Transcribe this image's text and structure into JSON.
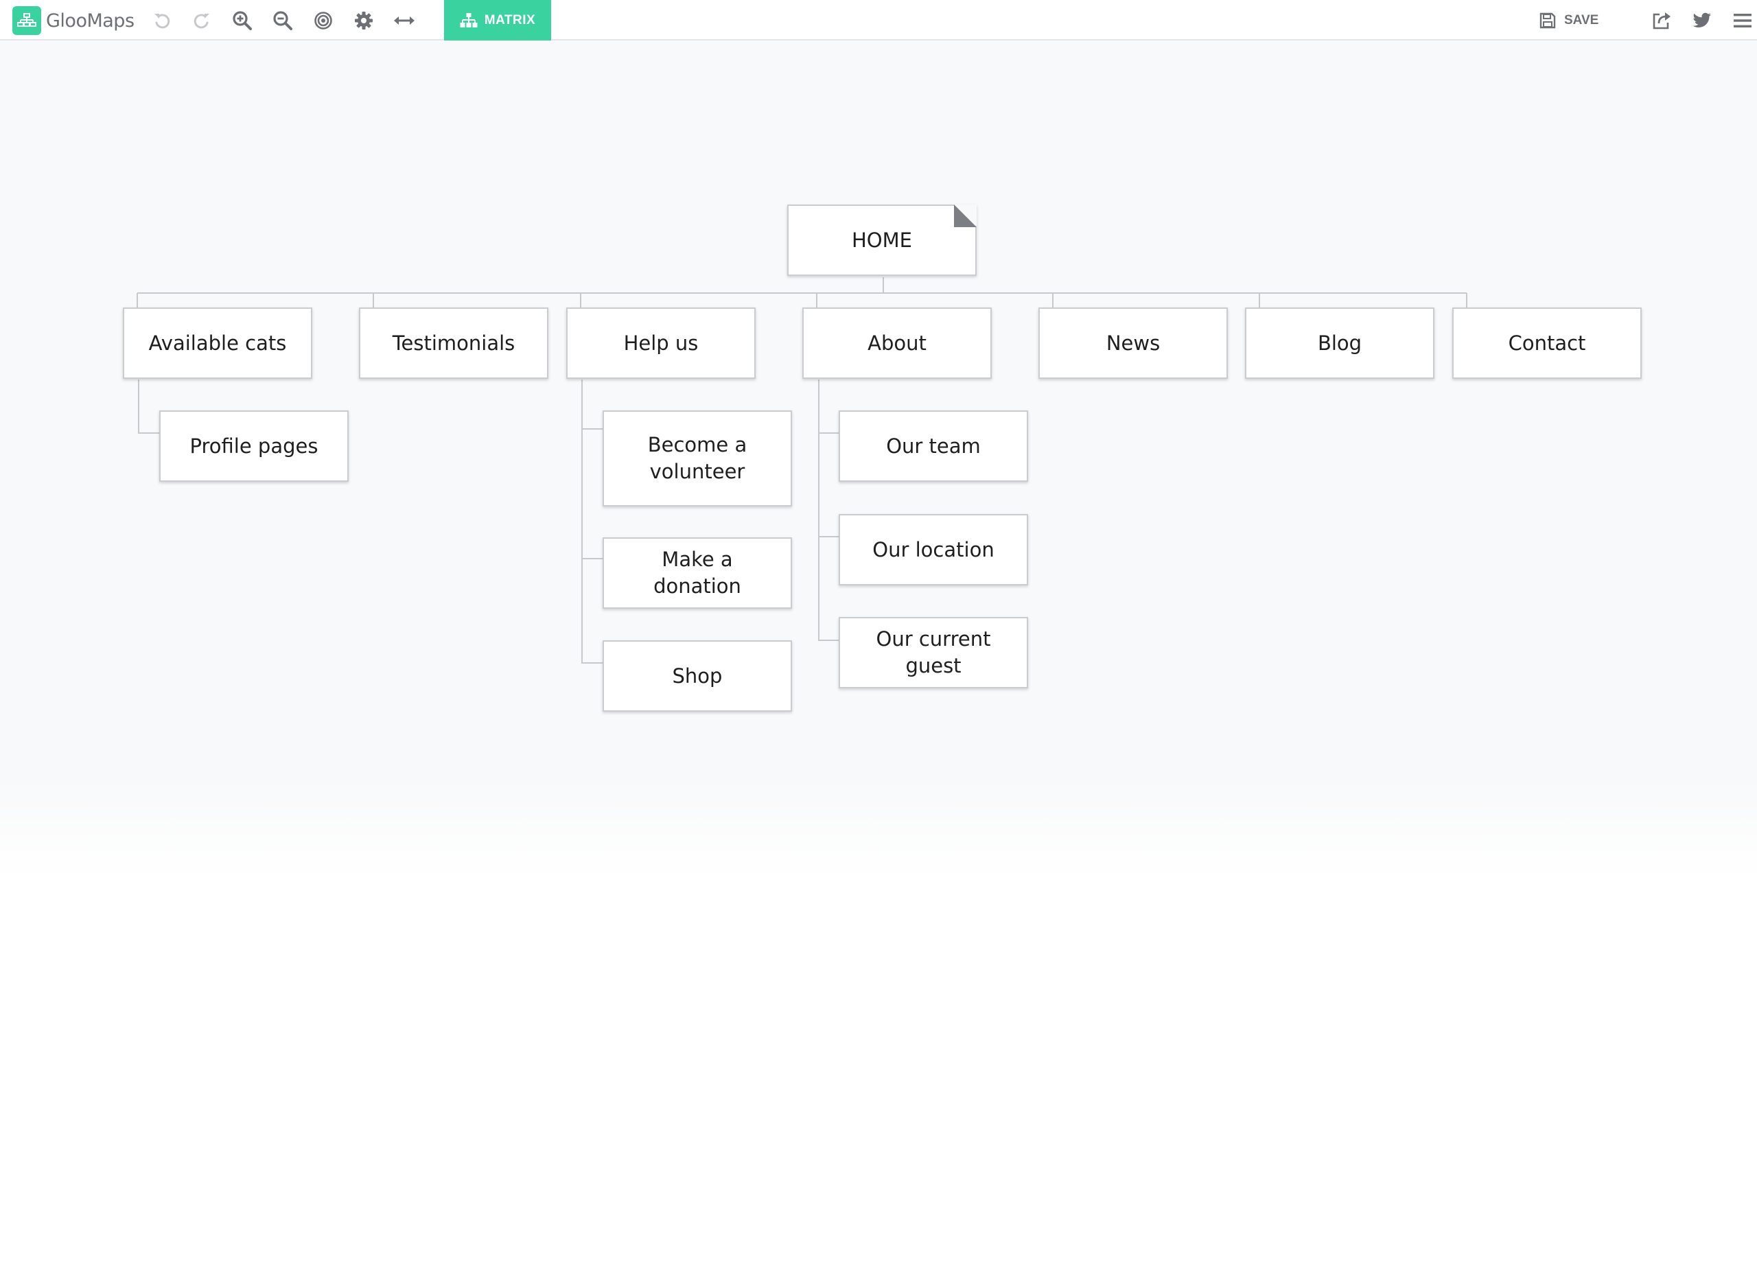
{
  "app": {
    "name": "GlooMaps",
    "accent": "#3ad29f"
  },
  "toolbar": {
    "tools": [
      {
        "icon": "undo-icon",
        "enabled": false
      },
      {
        "icon": "redo-icon",
        "enabled": false
      },
      {
        "icon": "zoom-in-icon",
        "enabled": true
      },
      {
        "icon": "zoom-out-icon",
        "enabled": true
      },
      {
        "icon": "target-icon",
        "enabled": true
      },
      {
        "icon": "gear-icon",
        "enabled": true
      },
      {
        "icon": "expand-horizontal-icon",
        "enabled": true
      }
    ],
    "matrix_label": "MATRIX",
    "save_label": "SAVE",
    "right_icons": [
      "share-icon",
      "twitter-icon",
      "menu-icon"
    ]
  },
  "sitemap": {
    "home": "HOME",
    "sections": [
      {
        "label": "Available cats",
        "children": [
          "Profile pages"
        ]
      },
      {
        "label": "Testimonials",
        "children": []
      },
      {
        "label": "Help us",
        "children": [
          "Become a volunteer",
          "Make a donation",
          "Shop"
        ]
      },
      {
        "label": "About",
        "children": [
          "Our team",
          "Our location",
          "Our current guest"
        ]
      },
      {
        "label": "News",
        "children": []
      },
      {
        "label": "Blog",
        "children": []
      },
      {
        "label": "Contact",
        "children": []
      }
    ]
  }
}
